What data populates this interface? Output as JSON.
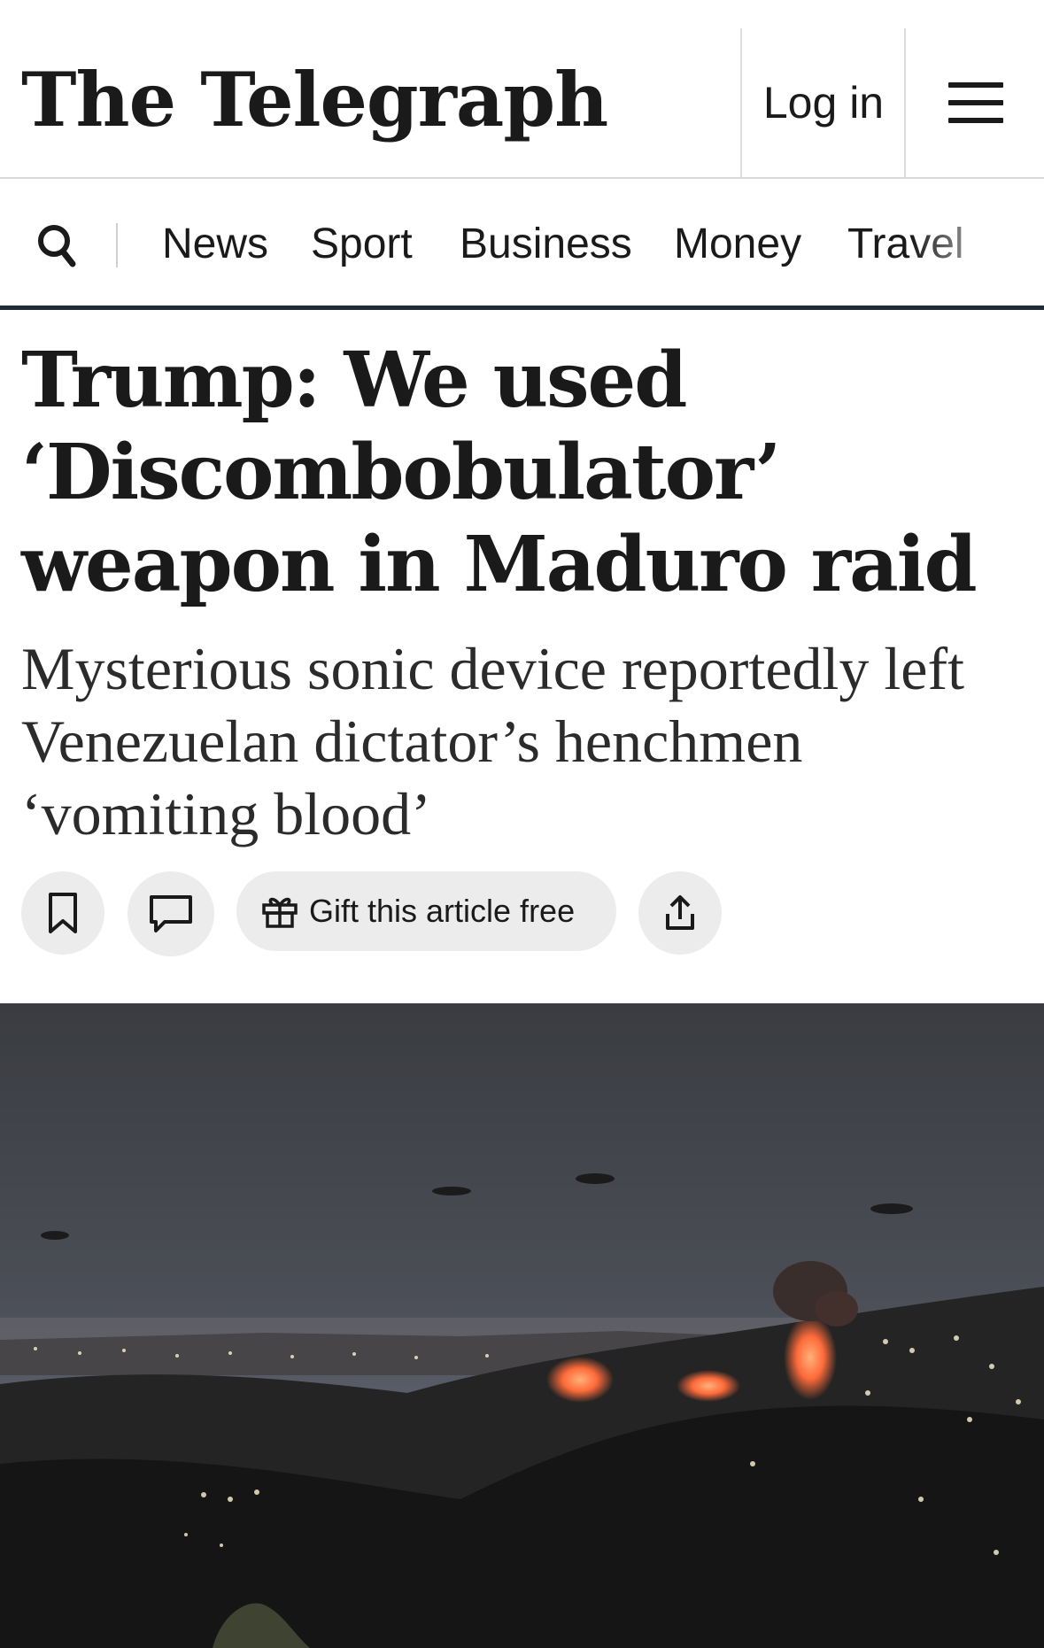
{
  "header": {
    "logo_text": "The Telegraph",
    "login_label": "Log in",
    "menu_icon": "hamburger-menu-icon"
  },
  "nav": {
    "search_icon": "search-icon",
    "items": [
      {
        "label": "News"
      },
      {
        "label": "Sport"
      },
      {
        "label": "Business"
      },
      {
        "label": "Money"
      },
      {
        "label": "Travel"
      }
    ]
  },
  "article": {
    "headline": "Trump: We used ‘Discombobulator’ weapon in Maduro raid",
    "standfirst": "Mysterious sonic device reportedly left Venezuelan dictator’s henchmen ‘vomiting blood’",
    "actions": {
      "bookmark_icon": "bookmark-icon",
      "comments_icon": "comment-icon",
      "gift_icon": "gift-icon",
      "gift_label": "Gift this article free",
      "share_icon": "share-icon"
    }
  },
  "colors": {
    "text": "#1a1a1a",
    "nav_rule": "#1f2a36",
    "button_bg": "#ececec"
  }
}
